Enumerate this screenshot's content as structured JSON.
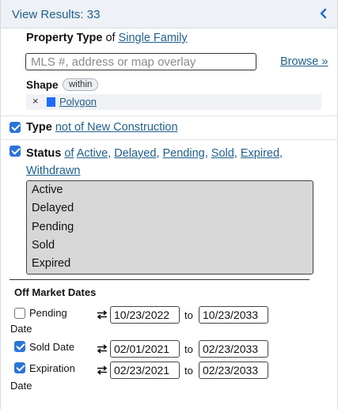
{
  "header": {
    "title": "View Results: 33"
  },
  "property_type": {
    "label": "Property Type",
    "of": "of",
    "value": "Single Family"
  },
  "search": {
    "placeholder": "MLS #, address or map overlay",
    "value": "",
    "browse_label": "Browse »"
  },
  "shape": {
    "label": "Shape",
    "badge": "within",
    "item_remove": "×",
    "item_label": "Polygon",
    "item_color": "#1f6bff"
  },
  "type_filter": {
    "checked": true,
    "label": "Type",
    "value": "not of New Construction"
  },
  "status_filter": {
    "checked": true,
    "label": "Status",
    "of": "of",
    "values": [
      "Active,",
      "Delayed,",
      "Pending,",
      "Sold,",
      "Expired,",
      "Withdrawn"
    ],
    "options": [
      "Active",
      "Delayed",
      "Pending",
      "Sold",
      "Expired"
    ]
  },
  "off_market": {
    "title": "Off Market Dates",
    "to_label": "to",
    "rows": [
      {
        "checked": false,
        "label_line1": "Pending",
        "label_line2": "Date",
        "from": "10/23/2022",
        "to": "10/23/2033"
      },
      {
        "checked": true,
        "label_line1": "Sold Date",
        "label_line2": "",
        "from": "02/01/2021",
        "to": "02/23/2033"
      },
      {
        "checked": true,
        "label_line1": "Expiration",
        "label_line2": "Date",
        "from": "02/23/2021",
        "to": "02/23/2033"
      }
    ]
  },
  "colors": {
    "accent": "#1f5f8b",
    "checkbox": "#2a74d8",
    "header_bg": "#eef1f5",
    "listbox_bg": "#d7d7d7"
  }
}
